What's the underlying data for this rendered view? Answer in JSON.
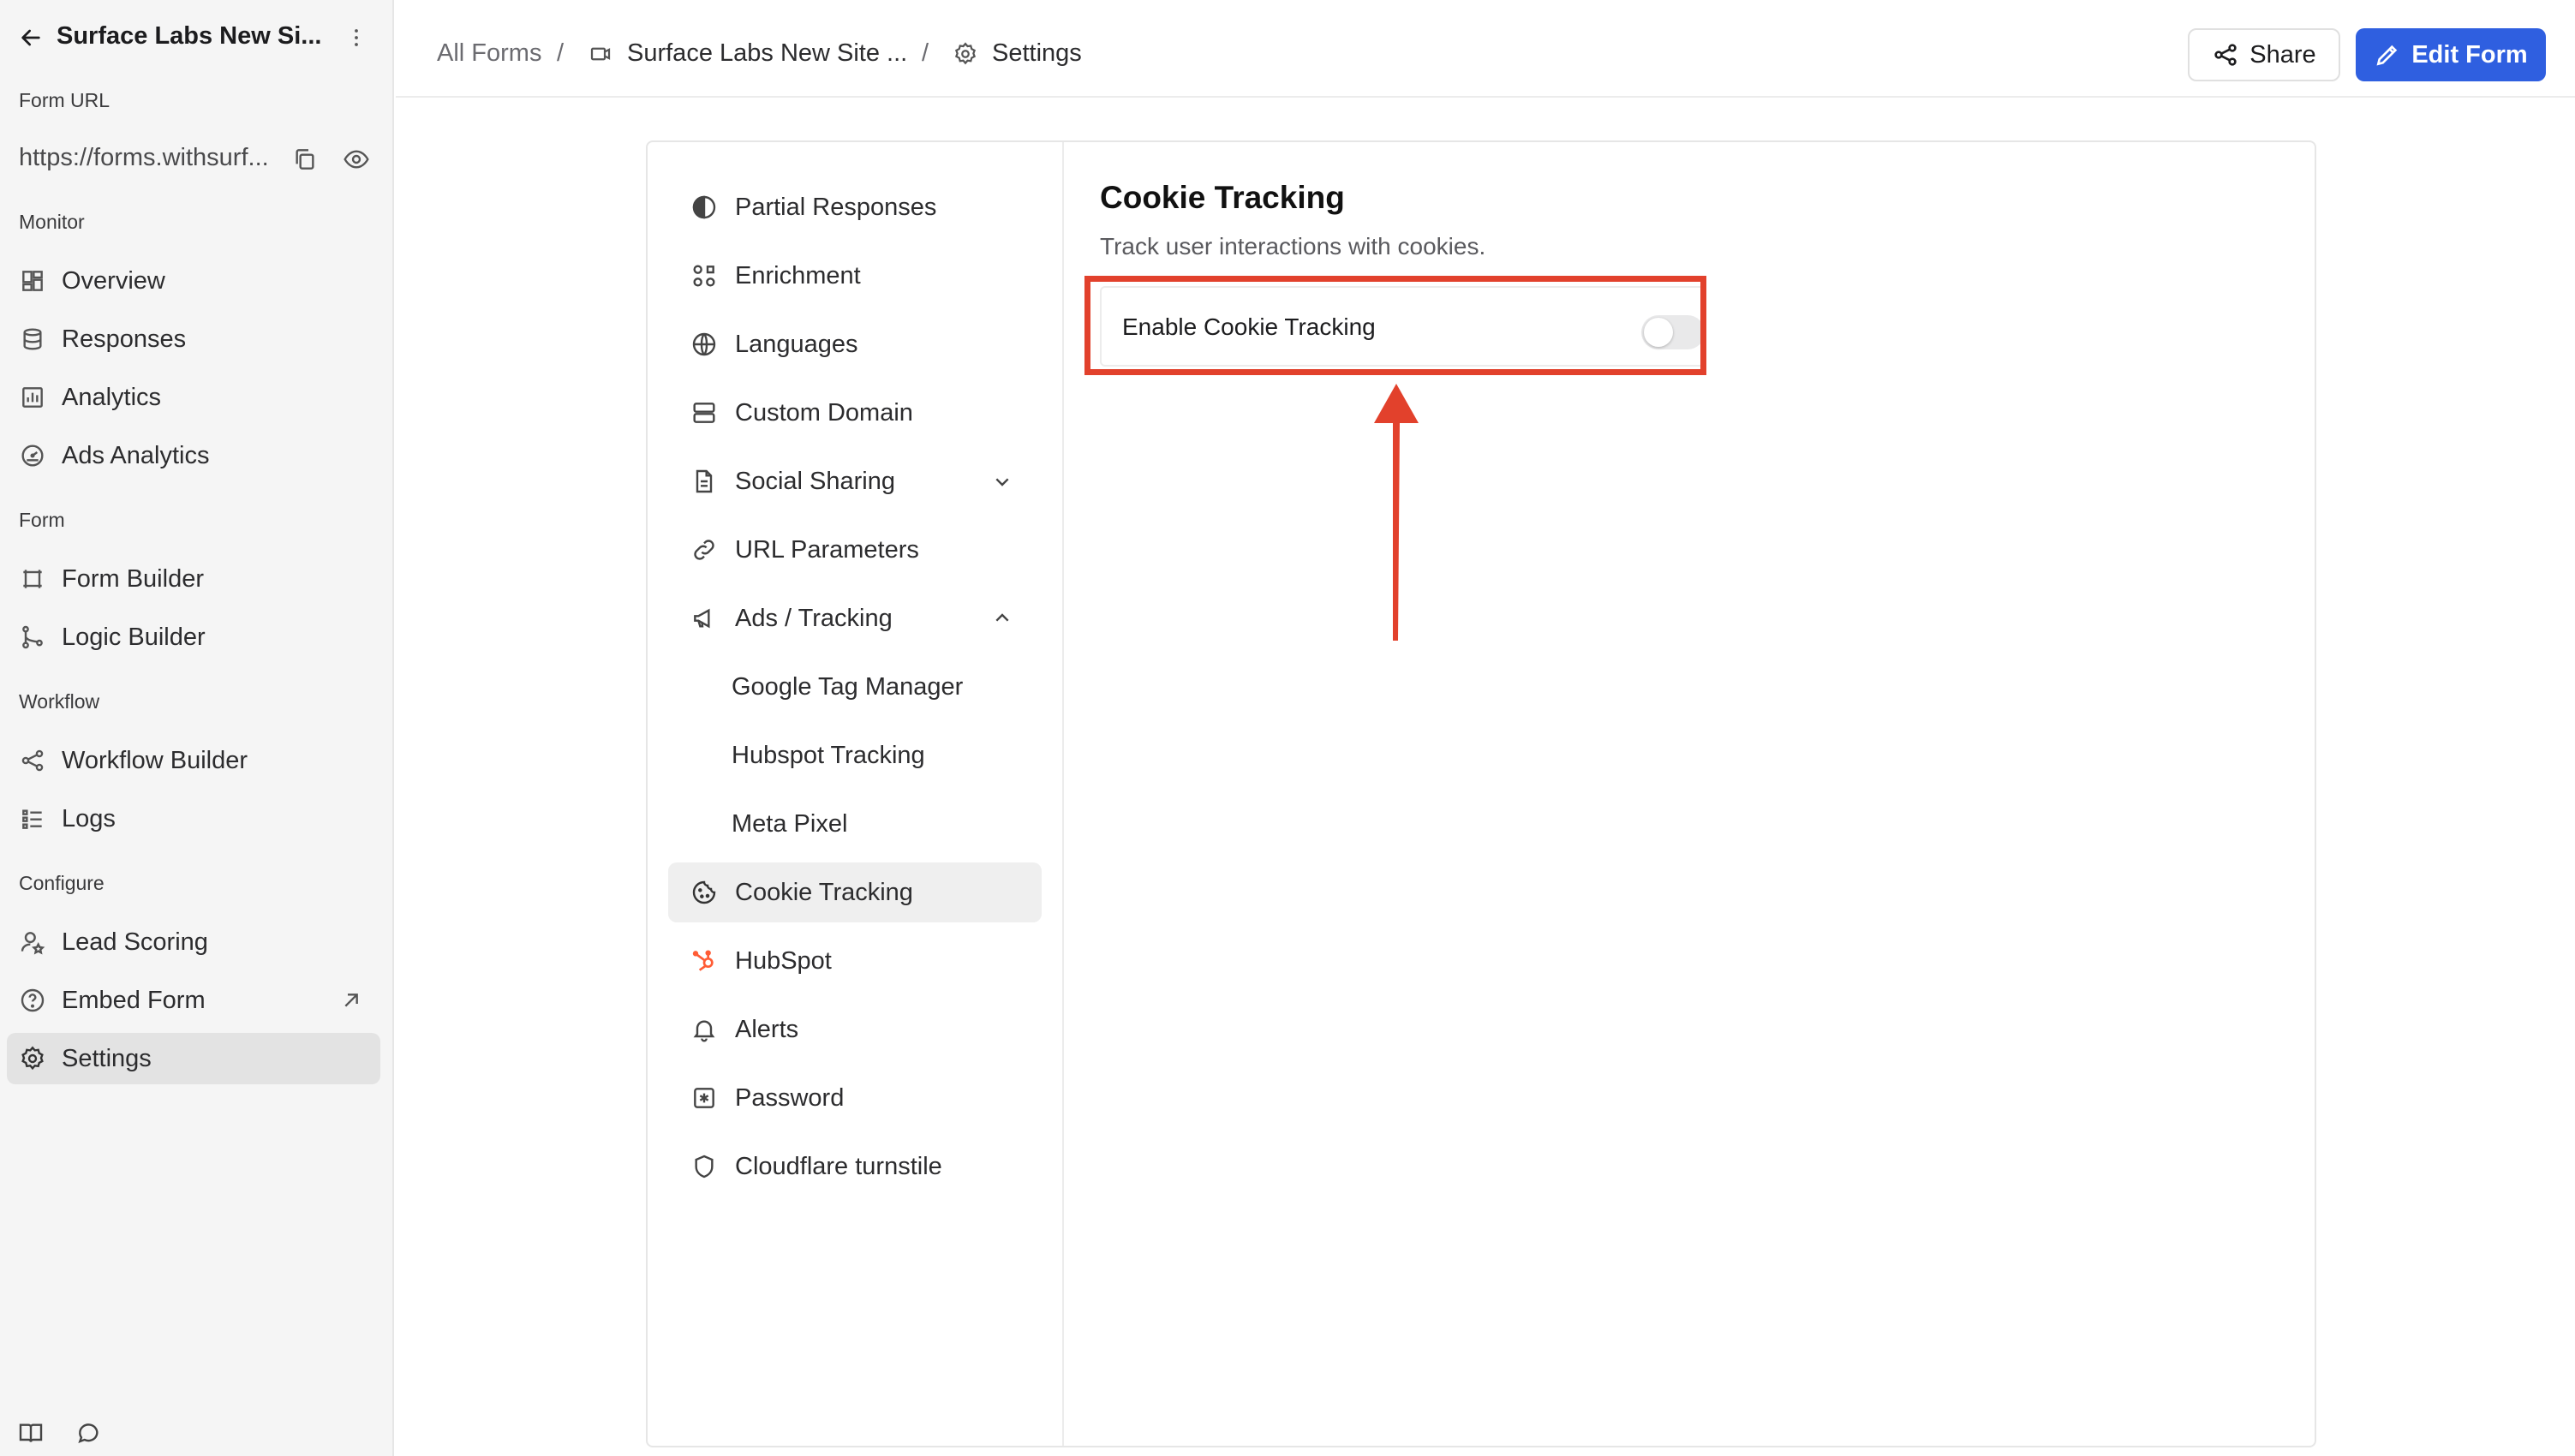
{
  "sidebar": {
    "form_title": "Surface Labs New Si...",
    "form_url_label": "Form URL",
    "form_url": "https://forms.withsurf...",
    "sections": {
      "monitor": "Monitor",
      "form": "Form",
      "workflow": "Workflow",
      "configure": "Configure"
    },
    "items": [
      {
        "label": "Overview",
        "icon": "dashboard-icon"
      },
      {
        "label": "Responses",
        "icon": "database-icon"
      },
      {
        "label": "Analytics",
        "icon": "bar-chart-icon"
      },
      {
        "label": "Ads Analytics",
        "icon": "gauge-icon"
      },
      {
        "label": "Form Builder",
        "icon": "frame-icon"
      },
      {
        "label": "Logic Builder",
        "icon": "git-branch-icon"
      },
      {
        "label": "Workflow Builder",
        "icon": "share-nodes-icon"
      },
      {
        "label": "Logs",
        "icon": "list-icon"
      },
      {
        "label": "Lead Scoring",
        "icon": "user-star-icon"
      },
      {
        "label": "Embed Form",
        "icon": "help-circle-icon"
      },
      {
        "label": "Settings",
        "icon": "gear-icon",
        "active": true
      }
    ]
  },
  "breadcrumb": {
    "all_forms": "All Forms",
    "sep": "/",
    "form_name": "Surface Labs New Site ...",
    "current": "Settings"
  },
  "header": {
    "share_label": "Share",
    "edit_label": "Edit Form",
    "accent_color": "#2f5fe0"
  },
  "settings_nav": [
    {
      "label": "Partial Responses",
      "icon": "half-circle-icon"
    },
    {
      "label": "Enrichment",
      "icon": "grid-dots-icon"
    },
    {
      "label": "Languages",
      "icon": "globe-icon"
    },
    {
      "label": "Custom Domain",
      "icon": "server-icon"
    },
    {
      "label": "Social Sharing",
      "icon": "document-icon",
      "expandable": true,
      "expanded": false
    },
    {
      "label": "URL Parameters",
      "icon": "link-icon"
    },
    {
      "label": "Ads / Tracking",
      "icon": "megaphone-icon",
      "expandable": true,
      "expanded": true
    },
    {
      "label": "Google Tag Manager",
      "sub": true
    },
    {
      "label": "Hubspot Tracking",
      "sub": true
    },
    {
      "label": "Meta Pixel",
      "sub": true
    },
    {
      "label": "Cookie Tracking",
      "icon": "cookie-icon",
      "active": true
    },
    {
      "label": "HubSpot",
      "icon": "hubspot-icon"
    },
    {
      "label": "Alerts",
      "icon": "bell-icon"
    },
    {
      "label": "Password",
      "icon": "asterisk-box-icon"
    },
    {
      "label": "Cloudflare turnstile",
      "icon": "shield-icon"
    }
  ],
  "content": {
    "title": "Cookie Tracking",
    "description": "Track user interactions with cookies.",
    "option_label": "Enable Cookie Tracking",
    "option_enabled": false
  },
  "annotation_color": "#e2412c"
}
